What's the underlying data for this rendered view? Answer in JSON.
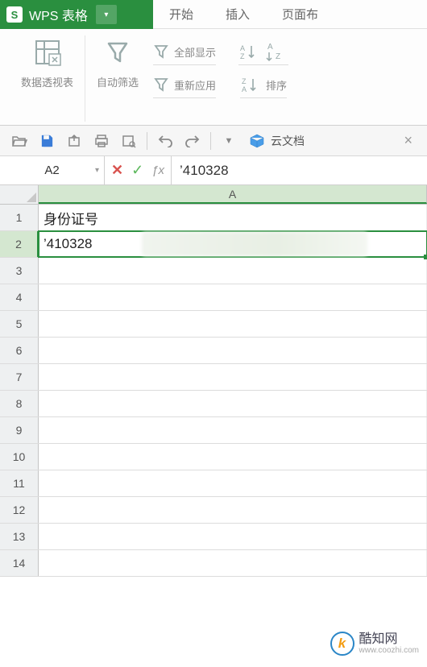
{
  "app": {
    "name": "WPS 表格",
    "logo_text": "S"
  },
  "menu": {
    "tabs": [
      "开始",
      "插入",
      "页面布"
    ]
  },
  "ribbon": {
    "pivot": {
      "label": "数据透视表"
    },
    "filter": {
      "label": "自动筛选"
    },
    "show_all": "全部显示",
    "reapply": "重新应用",
    "sort": {
      "label": "排序"
    }
  },
  "quick": {
    "cloud_doc": "云文档",
    "close": "×"
  },
  "formula_bar": {
    "cell_ref": "A2",
    "value": "'410328",
    "input_display": "’410328"
  },
  "sheet": {
    "col_header": "A",
    "rows": [
      {
        "num": "1",
        "value": "身份证号"
      },
      {
        "num": "2",
        "value": "’410328"
      },
      {
        "num": "3",
        "value": ""
      },
      {
        "num": "4",
        "value": ""
      },
      {
        "num": "5",
        "value": ""
      },
      {
        "num": "6",
        "value": ""
      },
      {
        "num": "7",
        "value": ""
      },
      {
        "num": "8",
        "value": ""
      },
      {
        "num": "9",
        "value": ""
      },
      {
        "num": "10",
        "value": ""
      },
      {
        "num": "11",
        "value": ""
      },
      {
        "num": "12",
        "value": ""
      },
      {
        "num": "13",
        "value": ""
      },
      {
        "num": "14",
        "value": ""
      }
    ],
    "active_row": 2
  },
  "watermark": {
    "logo": "k",
    "cn": "酷知网",
    "url": "www.coozhi.com"
  }
}
